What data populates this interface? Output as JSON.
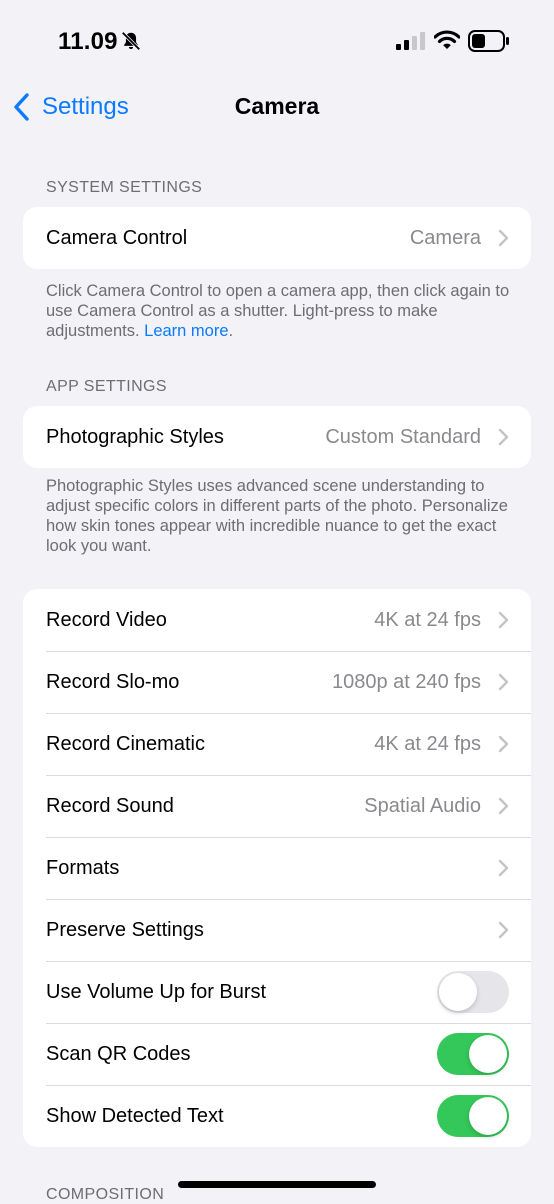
{
  "status_bar": {
    "time": "11.09",
    "icons": [
      "bell-slash-icon",
      "signal-icon",
      "wifi-icon",
      "battery-icon"
    ]
  },
  "nav": {
    "back_label": "Settings",
    "title": "Camera"
  },
  "system_settings": {
    "header": "SYSTEM SETTINGS",
    "rows": [
      {
        "label": "Camera Control",
        "value": "Camera"
      }
    ],
    "footer_text": "Click Camera Control to open a camera app, then click again to use Camera Control as a shutter. Light-press to make adjustments.",
    "footer_link": "Learn more",
    "footer_end": "."
  },
  "app_settings": {
    "header": "APP SETTINGS",
    "rows": [
      {
        "label": "Photographic Styles",
        "value": "Custom Standard"
      }
    ],
    "footer_text": "Photographic Styles uses advanced scene understanding to adjust specific colors in different parts of the photo. Personalize how skin tones appear with incredible nuance to get the exact look you want."
  },
  "camera_options": {
    "rows": [
      {
        "label": "Record Video",
        "value": "4K at 24 fps"
      },
      {
        "label": "Record Slo-mo",
        "value": "1080p at 240 fps"
      },
      {
        "label": "Record Cinematic",
        "value": "4K at 24 fps"
      },
      {
        "label": "Record Sound",
        "value": "Spatial Audio"
      },
      {
        "label": "Formats",
        "value": ""
      },
      {
        "label": "Preserve Settings",
        "value": ""
      }
    ],
    "toggles": [
      {
        "label": "Use Volume Up for Burst",
        "on": false
      },
      {
        "label": "Scan QR Codes",
        "on": true
      },
      {
        "label": "Show Detected Text",
        "on": true
      }
    ]
  },
  "composition_header": "COMPOSITION",
  "colors": {
    "accent": "#0a7aff",
    "toggle_on": "#34c759",
    "background": "#f2f2f7"
  }
}
